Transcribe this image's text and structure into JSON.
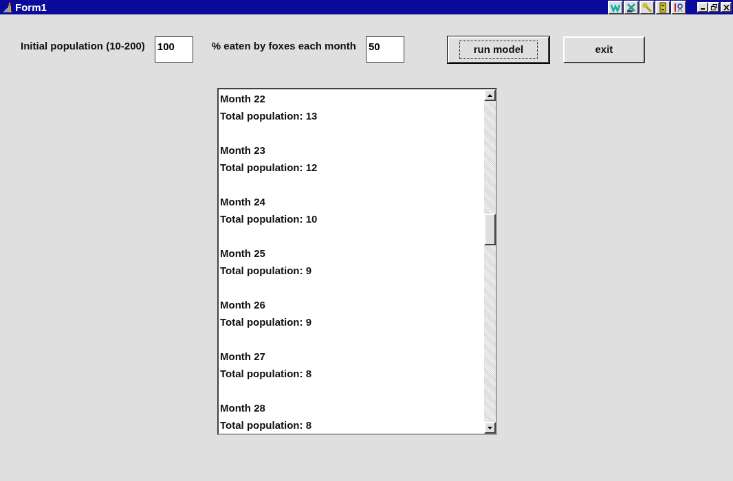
{
  "window": {
    "title": "Form1"
  },
  "inputs": [
    {
      "label": "Initial population (10-200)",
      "value": "100"
    },
    {
      "label": "% eaten by foxes each month",
      "value": "50"
    }
  ],
  "buttons": [
    {
      "label": "run model",
      "focused": true
    },
    {
      "label": "exit",
      "focused": false
    }
  ],
  "output_list": [
    {
      "month": "Month 22",
      "total": "Total population: 13"
    },
    {
      "month": "Month 23",
      "total": "Total population: 12"
    },
    {
      "month": "Month 24",
      "total": "Total population: 10"
    },
    {
      "month": "Month 25",
      "total": "Total population: 9"
    },
    {
      "month": "Month 26",
      "total": "Total population: 9"
    },
    {
      "month": "Month 27",
      "total": "Total population: 8"
    },
    {
      "month": "Month 28",
      "total": "Total population: 8"
    }
  ]
}
